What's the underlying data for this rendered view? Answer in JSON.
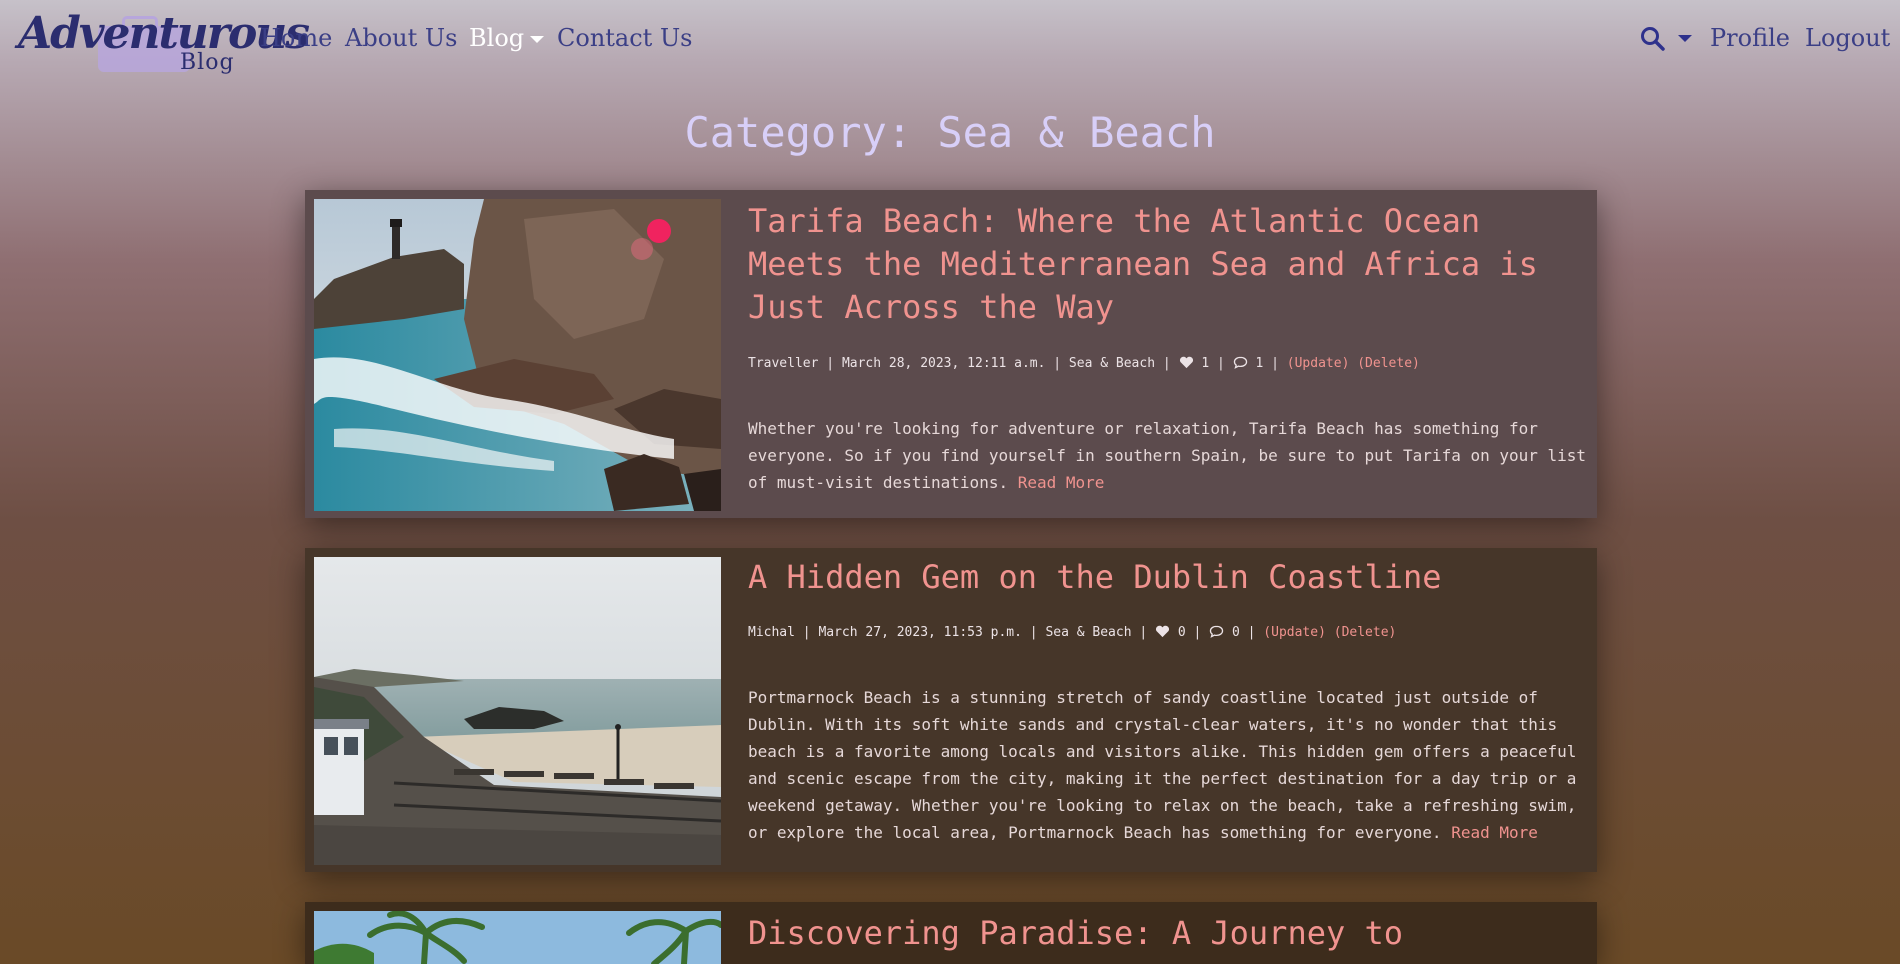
{
  "brand": {
    "line1": "Adventurous",
    "line2": "Blog"
  },
  "nav": {
    "home": "Home",
    "about": "About Us",
    "blog": "Blog",
    "contact": "Contact Us",
    "profile": "Profile",
    "logout": "Logout"
  },
  "page": {
    "title": "Category: Sea & Beach"
  },
  "posts": [
    {
      "title": "Tarifa Beach: Where the Atlantic Ocean Meets the Mediterranean Sea and Africa is Just Across the Way",
      "author": "Traveller",
      "date": "March 28, 2023, 12:11 a.m.",
      "category": "Sea & Beach",
      "likes": "1",
      "comments": "1",
      "update": "(Update)",
      "delete": "(Delete)",
      "excerpt": "Whether you're looking for adventure or relaxation, Tarifa Beach has something for everyone. So if you find yourself in southern Spain, be sure to put Tarifa on your list of must-visit destinations.",
      "read_more": "Read More"
    },
    {
      "title": "A Hidden Gem on the Dublin Coastline",
      "author": "Michal",
      "date": "March 27, 2023, 11:53 p.m.",
      "category": "Sea & Beach",
      "likes": "0",
      "comments": "0",
      "update": "(Update)",
      "delete": "(Delete)",
      "excerpt": "Portmarnock Beach is a stunning stretch of sandy coastline located just outside of Dublin. With its soft white sands and crystal-clear waters, it's no wonder that this beach is a favorite among locals and visitors alike. This hidden gem offers a peaceful and scenic escape from the city, making it the perfect destination for a day trip or a weekend getaway. Whether you're looking to relax on the beach, take a refreshing swim, or explore the local area, Portmarnock Beach has something for everyone.",
      "read_more": "Read More"
    },
    {
      "title": "Discovering Paradise: A Journey to"
    }
  ],
  "icons": {
    "search": "search-icon",
    "like": "heart-icon",
    "comment": "comment-icon"
  },
  "colors": {
    "title_accent": "#f0938f",
    "nav_link": "#3b3f86",
    "heading": "#d8cff8"
  }
}
